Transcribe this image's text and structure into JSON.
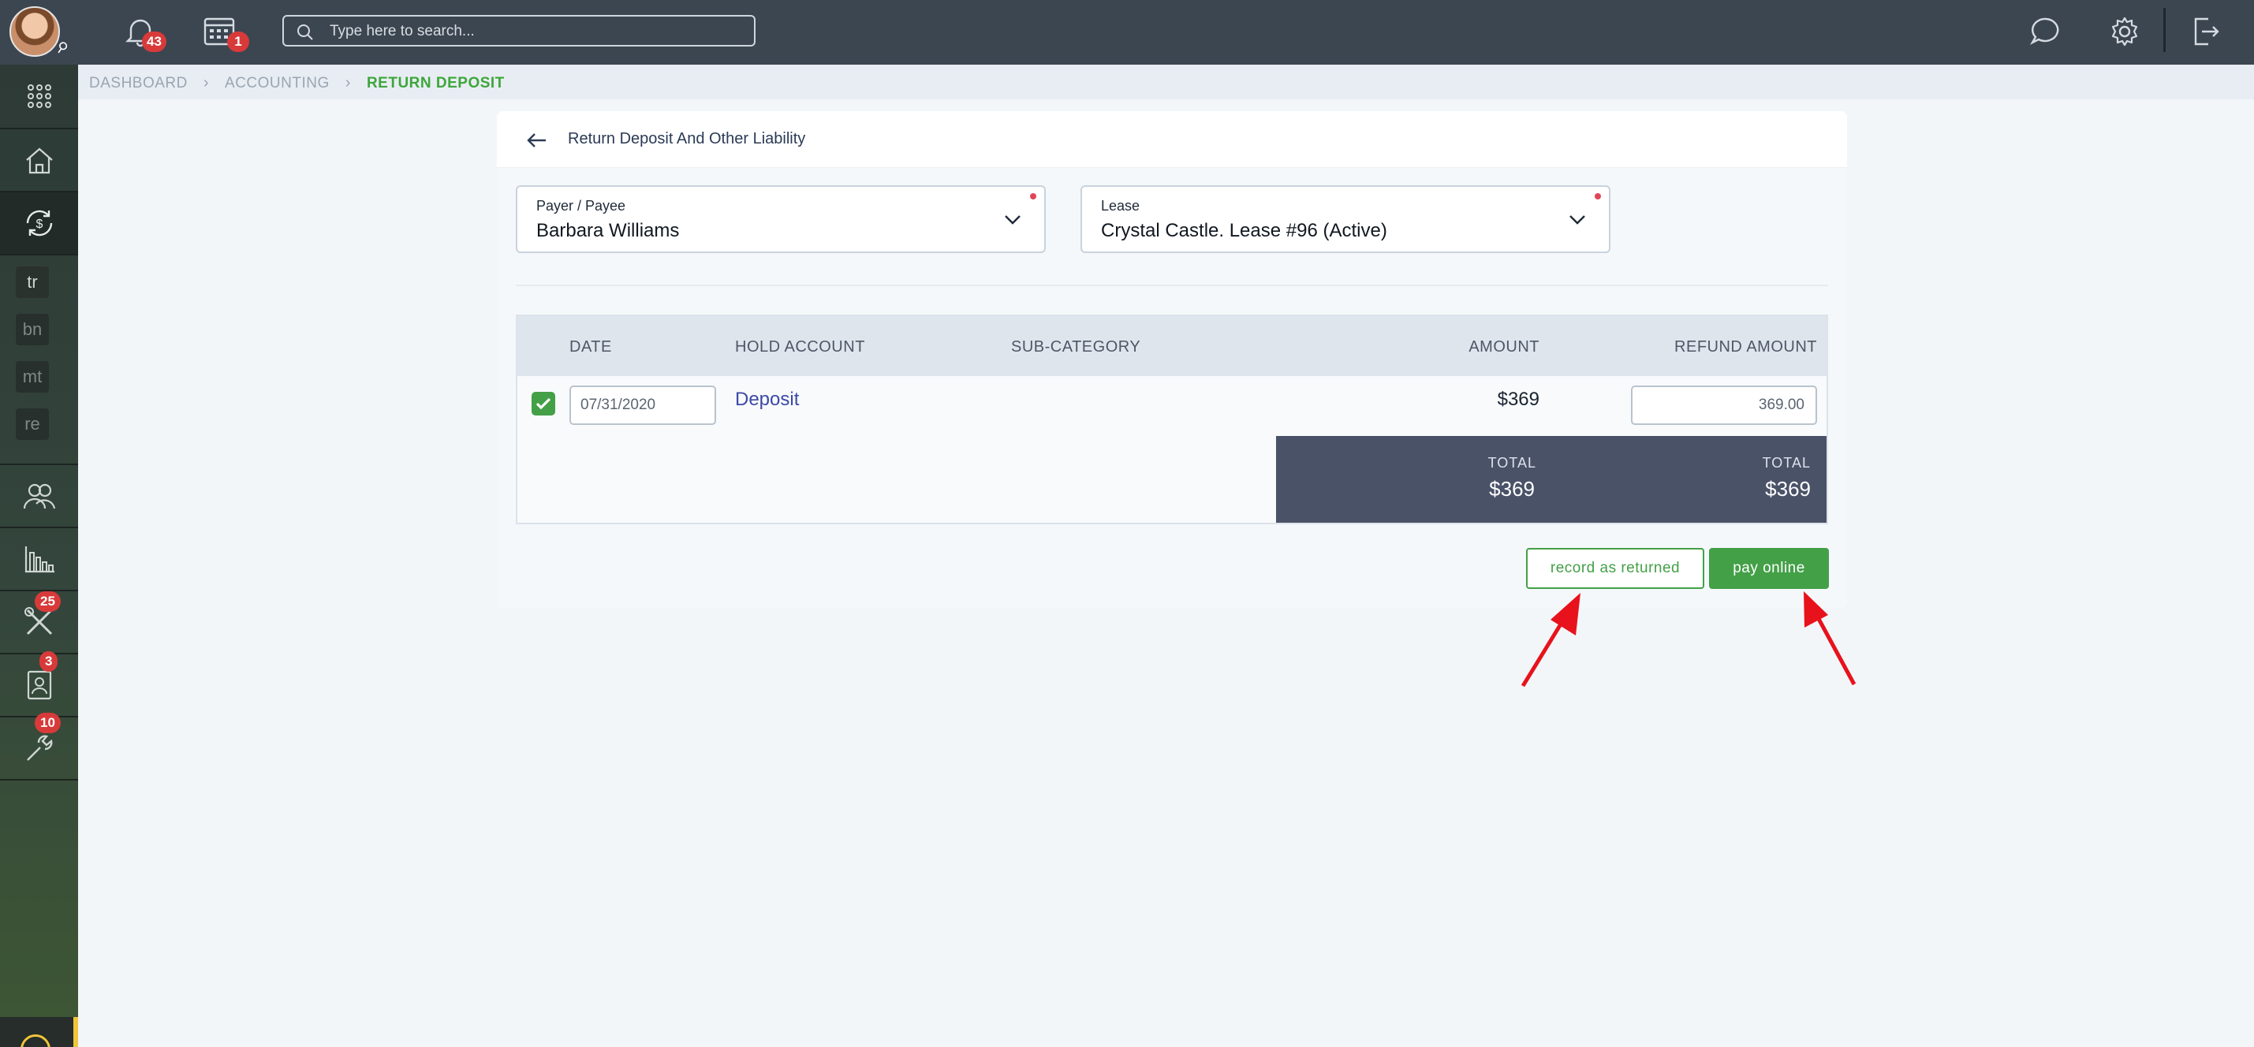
{
  "topbar": {
    "notifications_count": "43",
    "calendar_count": "1",
    "search_placeholder": "Type here to search..."
  },
  "sidebar": {
    "text_items": [
      "tr",
      "bn",
      "mt",
      "re"
    ],
    "badges": {
      "maintenance": "25",
      "contacts": "3",
      "tools": "10"
    }
  },
  "breadcrumb": {
    "items": [
      "DASHBOARD",
      "ACCOUNTING"
    ],
    "current": "RETURN DEPOSIT"
  },
  "form": {
    "title": "Return Deposit And Other Liability",
    "payer": {
      "label": "Payer / Payee",
      "value": "Barbara Williams"
    },
    "lease": {
      "label": "Lease",
      "value": "Crystal Castle. Lease #96 (Active)"
    }
  },
  "table": {
    "headers": {
      "date": "DATE",
      "hold_account": "HOLD ACCOUNT",
      "sub_category": "SUB-CATEGORY",
      "amount": "AMOUNT",
      "refund_amount": "REFUND AMOUNT"
    },
    "rows": [
      {
        "checked": true,
        "date": "07/31/2020",
        "hold_account": "Deposit",
        "sub_category": "",
        "amount": "$369",
        "refund_amount": "369.00"
      }
    ],
    "totals": {
      "amount_label": "TOTAL",
      "amount_value": "$369",
      "refund_label": "TOTAL",
      "refund_value": "$369"
    }
  },
  "actions": {
    "record_label": "record as returned",
    "pay_label": "pay online"
  },
  "colors": {
    "accent_green": "#43a047",
    "topbar": "#3c4651",
    "badge_red": "#d83a3a",
    "annotation_red": "#e8121c"
  }
}
